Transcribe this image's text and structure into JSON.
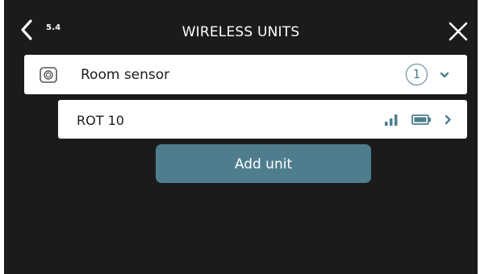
{
  "header": {
    "menu_number": "5.4",
    "title": "WIRELESS UNITS",
    "back_icon": "chevron-left-icon",
    "close_icon": "close-icon"
  },
  "sensor_group": {
    "label": "Room sensor",
    "icon": "room-sensor-icon",
    "count": "1",
    "expand_icon": "chevron-down-icon"
  },
  "units": [
    {
      "label": "ROT 10",
      "signal_icon": "signal-strength-icon",
      "battery_icon": "battery-icon",
      "open_icon": "chevron-right-icon"
    }
  ],
  "actions": {
    "add_unit_label": "Add unit"
  },
  "colors": {
    "background": "#1c1b1b",
    "accent": "#4e7e8e",
    "row_background": "#ffffff",
    "text_dark": "#1c1b1b"
  }
}
